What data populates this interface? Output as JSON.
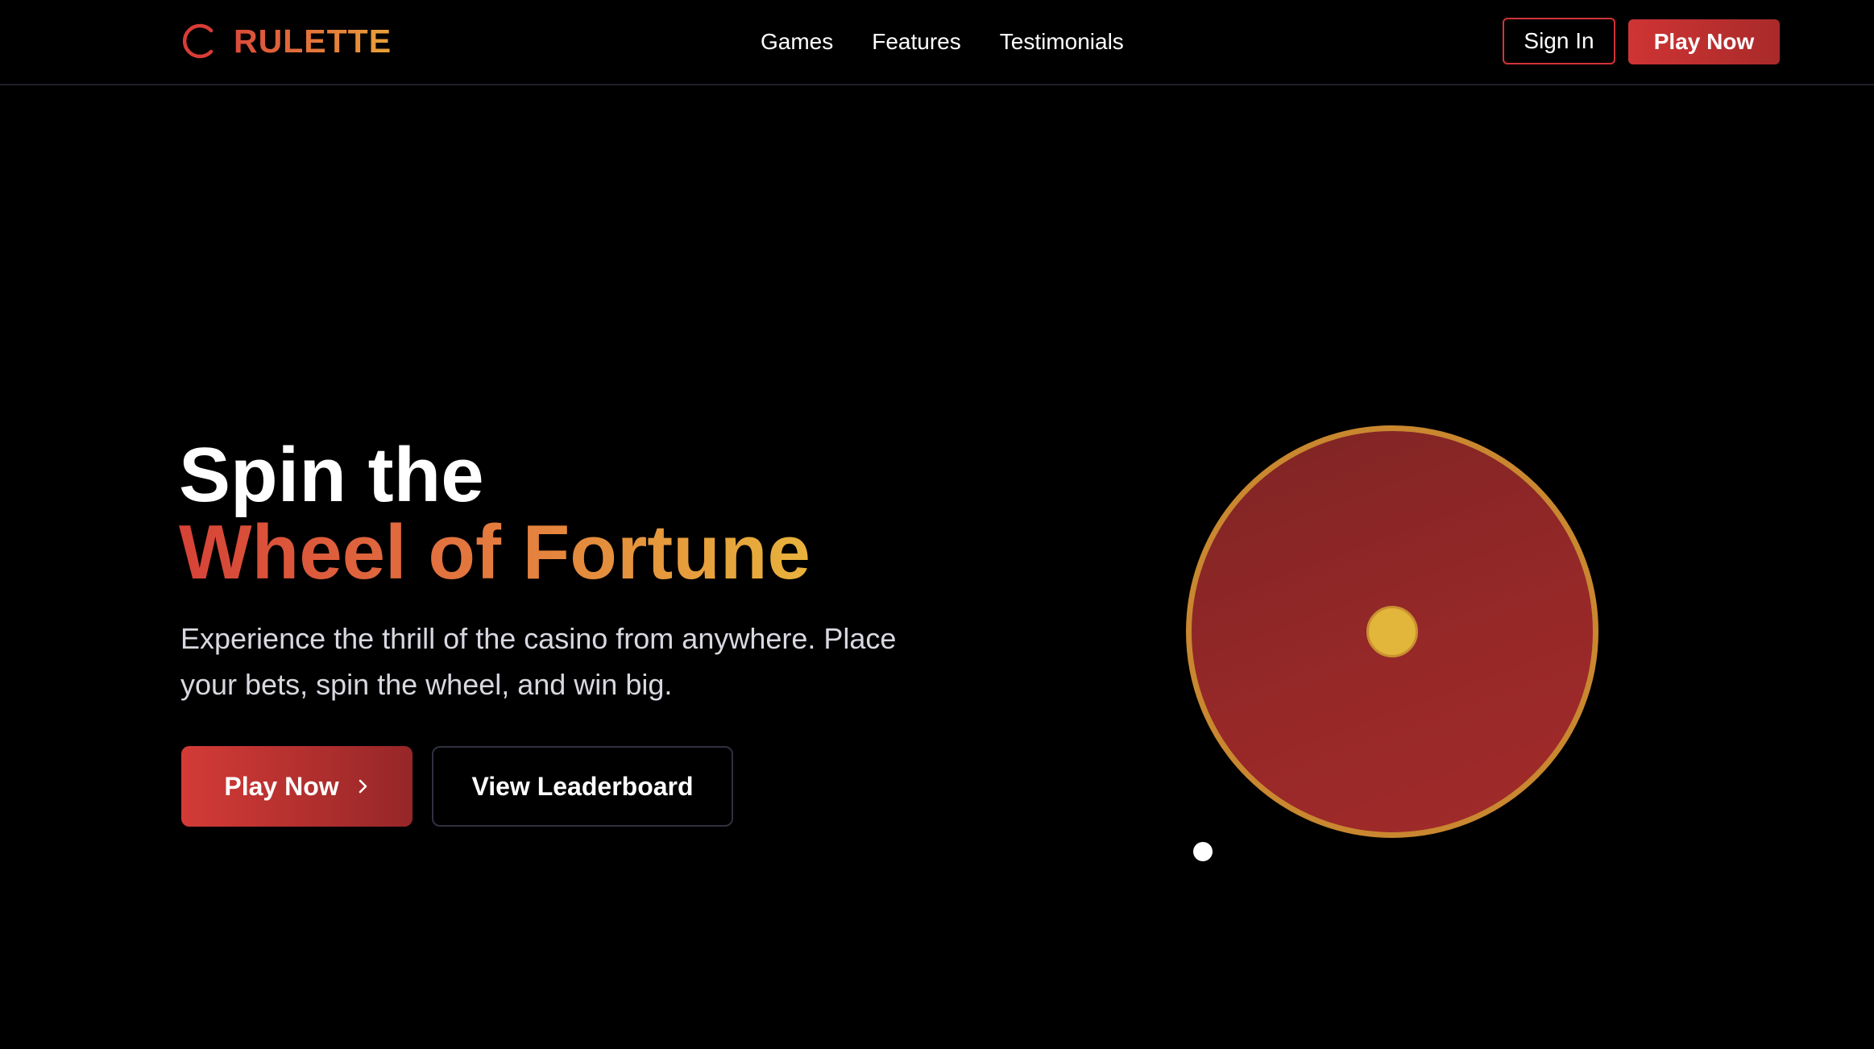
{
  "header": {
    "brand_name": "RULETTE",
    "brand_icon": "circle-arc-icon",
    "nav": [
      {
        "label": "Games"
      },
      {
        "label": "Features"
      },
      {
        "label": "Testimonials"
      }
    ],
    "sign_in_label": "Sign In",
    "play_now_label": "Play Now"
  },
  "hero": {
    "title_line1": "Spin the",
    "title_line2": "Wheel of Fortune",
    "subtitle": "Experience the thrill of the casino from anywhere. Place your bets, spin the wheel, and win big.",
    "primary_button_label": "Play Now",
    "primary_button_icon": "chevron-right-icon",
    "secondary_button_label": "View Leaderboard"
  },
  "colors": {
    "background": "#000000",
    "brand_red": "#d0343a",
    "gradient_start": "#d64237",
    "gradient_end": "#e8b33c",
    "wheel_fill": "#962828",
    "wheel_rim": "#c9872f",
    "wheel_center": "#e2b53b"
  }
}
